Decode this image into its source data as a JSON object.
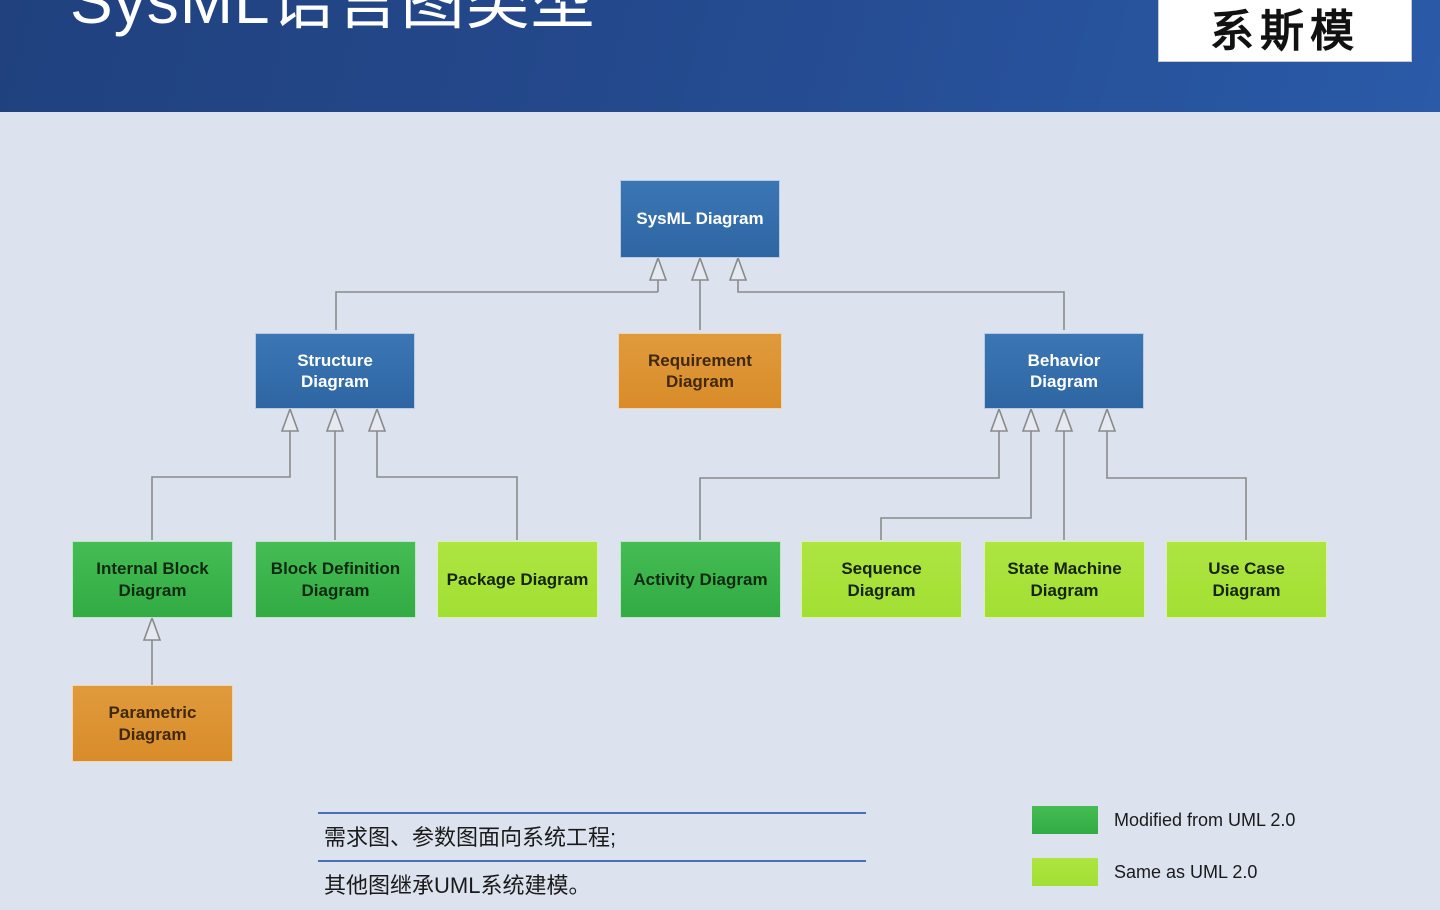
{
  "header": {
    "title": "SysML语言图类型",
    "badge": "系斯模"
  },
  "diagram": {
    "root": {
      "label": "SysML Diagram",
      "type": "blue"
    },
    "tier2": [
      {
        "label": "Structure\nDiagram",
        "type": "blue"
      },
      {
        "label": "Requirement\nDiagram",
        "type": "orange"
      },
      {
        "label": "Behavior\nDiagram",
        "type": "blue"
      }
    ],
    "leaves": [
      {
        "label": "Internal Block\nDiagram",
        "type": "green"
      },
      {
        "label": "Block Definition\nDiagram",
        "type": "green"
      },
      {
        "label": "Package Diagram",
        "type": "lime"
      },
      {
        "label": "Activity Diagram",
        "type": "green"
      },
      {
        "label": "Sequence\nDiagram",
        "type": "lime"
      },
      {
        "label": "State Machine\nDiagram",
        "type": "lime"
      },
      {
        "label": "Use Case\nDiagram",
        "type": "lime"
      }
    ],
    "parametric": {
      "label": "Parametric\nDiagram",
      "type": "orange"
    }
  },
  "caption": {
    "line1": "需求图、参数图面向系统工程;",
    "line2": "其他图继承UML系统建模。"
  },
  "legend": {
    "items": [
      {
        "label": "Modified from UML 2.0",
        "swatch": "green"
      },
      {
        "label": "Same as UML 2.0",
        "swatch": "lime"
      }
    ]
  },
  "colors": {
    "header_blue": "#24498d",
    "canvas_bg": "#dde3ee",
    "node_blue": "#2e66a3",
    "node_orange": "#d98c29",
    "node_green": "#33ab44",
    "node_lime": "#a2df33",
    "wire": "#8a8a8a",
    "rule_blue": "#4a6fb5"
  }
}
